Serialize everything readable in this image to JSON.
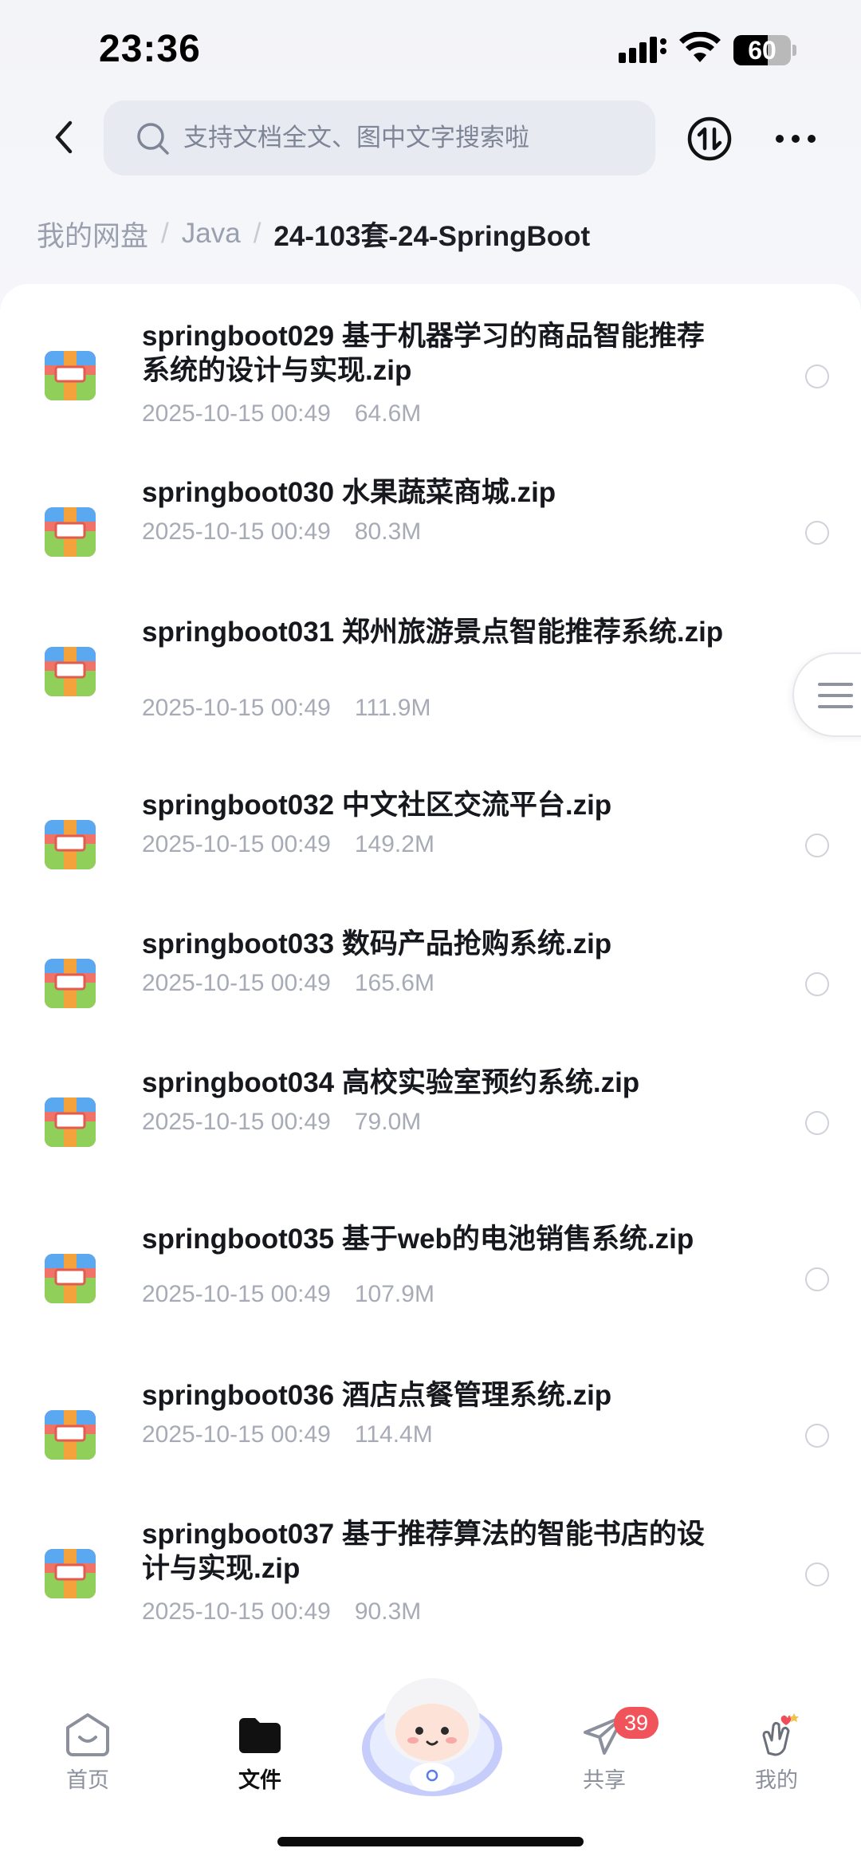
{
  "status_bar": {
    "time": "23:36",
    "battery": "60",
    "battery_level_percent": 60
  },
  "header": {
    "search_placeholder": "支持文档全文、图中文字搜索啦"
  },
  "breadcrumb": {
    "root": "我的网盘",
    "parent": "Java",
    "current": "24-103套-24-SpringBoot",
    "separator": "/"
  },
  "files": [
    {
      "name": "springboot029 基于机器学习的商品智能推荐系统的设计与实现.zip",
      "date": "2025-10-15 00:49",
      "size": "64.6M"
    },
    {
      "name": "springboot030 水果蔬菜商城.zip",
      "date": "2025-10-15 00:49",
      "size": "80.3M"
    },
    {
      "name": "springboot031 郑州旅游景点智能推荐系统.zip",
      "date": "2025-10-15 00:49",
      "size": "111.9M"
    },
    {
      "name": "springboot032 中文社区交流平台.zip",
      "date": "2025-10-15 00:49",
      "size": "149.2M"
    },
    {
      "name": "springboot033 数码产品抢购系统.zip",
      "date": "2025-10-15 00:49",
      "size": "165.6M"
    },
    {
      "name": "springboot034 高校实验室预约系统.zip",
      "date": "2025-10-15 00:49",
      "size": "79.0M"
    },
    {
      "name": "springboot035 基于web的电池销售系统.zip",
      "date": "2025-10-15 00:49",
      "size": "107.9M"
    },
    {
      "name": "springboot036 酒店点餐管理系统.zip",
      "date": "2025-10-15 00:49",
      "size": "114.4M"
    },
    {
      "name": "springboot037 基于推荐算法的智能书店的设计与实现.zip",
      "date": "2025-10-15 00:49",
      "size": "90.3M"
    }
  ],
  "file_icon": "zip-archive-icon",
  "tab_bar": {
    "home": "首页",
    "files": "文件",
    "share": "共享",
    "share_badge": "39",
    "mine": "我的"
  },
  "colors": {
    "accent": "#111111",
    "badge": "#f0545a",
    "muted_text": "#a7abb6"
  }
}
